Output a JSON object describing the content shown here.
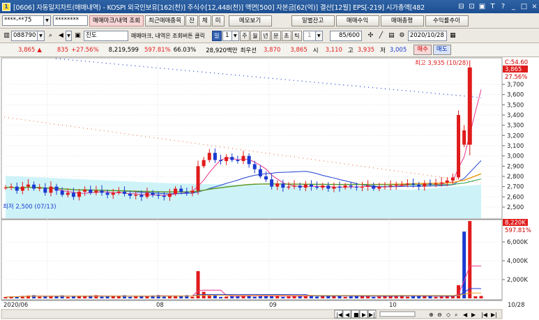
{
  "titlebar": {
    "icon": "1",
    "title": "[0606] 자동일지차트(매매내역) - KOSPI 외국인보유[162(천)] 주식수[12,448(천)] 액면[500] 자본금[62(억)] 결산[12월] EPS[-219] 시가총액[482",
    "buttons": [
      "⊟",
      "⊡",
      "▣",
      "T",
      "?",
      "_",
      "□",
      "×"
    ]
  },
  "toolbar1": {
    "account": "****-**75",
    "password": "********",
    "btn_trade_mark": "매매마크/내역 조회",
    "btn_recent": "최근매매종목",
    "btn_jan": "잔",
    "btn_che": "체",
    "btn_mi": "미",
    "btn_memo": "메모보기",
    "btn_daily_balance": "일별잔고",
    "btn_profit": "매매수익",
    "btn_general": "매매총평",
    "btn_return": "수익률추이"
  },
  "toolbar2": {
    "code": "088790",
    "stock_name": "진도",
    "hint": "매매마크, 내역은 조회버튼 클릭",
    "period_sel": "일",
    "period_num": "1",
    "periods": [
      "주",
      "월",
      "년",
      "분",
      "초",
      "틱"
    ],
    "tick_num": "1",
    "count": "85/600",
    "date": "2020/10/28"
  },
  "quote": {
    "price": "3,865",
    "arrow": "▲",
    "change": "835",
    "rate": "+27.56%",
    "volume": "8,219,599",
    "vol_rate": "597.81%",
    "strength": "66.03%",
    "amount": "28,920백만",
    "prior_label": "최우선",
    "prior": "3,870",
    "cur": "3,865",
    "open_label": "시",
    "open": "3,110",
    "high_label": "고",
    "high": "3,935",
    "low_label": "저",
    "low": "3,005",
    "buy": "매수",
    "sell": "매도"
  },
  "price_chart": {
    "high_label": "최고 3,935 (10/28)",
    "low_label": "최저 2,500 (07/13)",
    "right_top": "C:54.60",
    "right_price": "3,865",
    "right_rate": "27.56%",
    "y_ticks": [
      "3,700",
      "3,600",
      "3,500",
      "3,400",
      "3,300",
      "3,200",
      "3,100",
      "3,000",
      "2,900",
      "2,800",
      "2,700",
      "2,600",
      "2,500"
    ]
  },
  "volume_chart": {
    "right_vol": "8,220K",
    "right_rate": "597.81%",
    "y_ticks": [
      "6,000K",
      "4,000K",
      "2,000K"
    ]
  },
  "x_axis": {
    "labels": [
      "2020/06",
      "08",
      "09",
      "10",
      "10/28"
    ]
  },
  "colors": {
    "up": "#e01b1b",
    "down": "#1a3ad0",
    "ma5": "#e8358a",
    "ma20": "#2040d0",
    "ma60": "#e8a020",
    "ma120": "#20a040",
    "band_fill": "#cdf3f8"
  }
}
